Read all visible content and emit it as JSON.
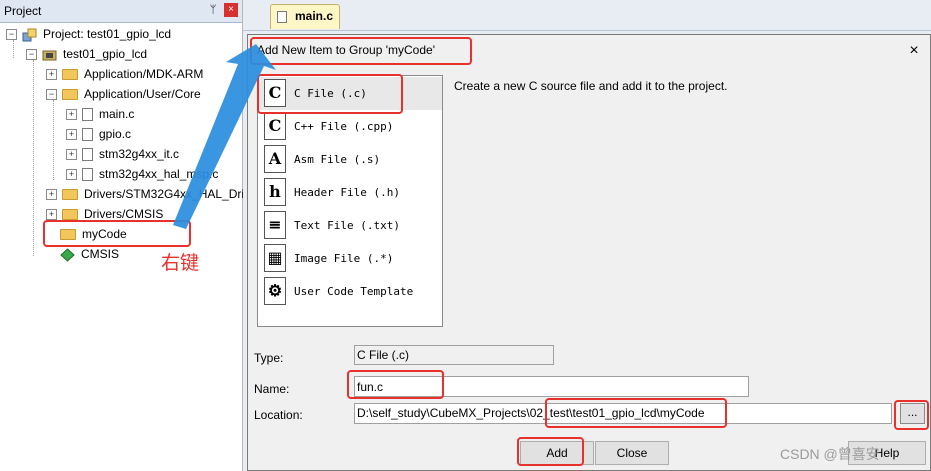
{
  "project_panel": {
    "title": "Project",
    "pin": "ᛘ",
    "close": "×",
    "tree": {
      "project": "Project: test01_gpio_lcd",
      "target": "test01_gpio_lcd",
      "groups": [
        "Application/MDK-ARM",
        "Application/User/Core",
        "Drivers/STM32G4xx_HAL_Dri",
        "Drivers/CMSIS",
        "myCode",
        "CMSIS"
      ],
      "files": [
        "main.c",
        "gpio.c",
        "stm32g4xx_it.c",
        "stm32g4xx_hal_msp.c"
      ]
    }
  },
  "editor": {
    "active_tab": "main.c"
  },
  "dialog": {
    "title": "Add New Item to Group 'myCode'",
    "close": "×",
    "description": "Create a new C source file and add it to the project.",
    "templates": [
      {
        "label": "C File (.c)",
        "glyph": "C",
        "icon": "c-file-icon"
      },
      {
        "label": "C++ File (.cpp)",
        "glyph": "C",
        "icon": "cpp-file-icon"
      },
      {
        "label": "Asm File (.s)",
        "glyph": "A",
        "icon": "asm-file-icon"
      },
      {
        "label": "Header File (.h)",
        "glyph": "h",
        "icon": "header-file-icon"
      },
      {
        "label": "Text File (.txt)",
        "glyph": "≡",
        "icon": "text-file-icon"
      },
      {
        "label": "Image File (.*)",
        "glyph": "▦",
        "icon": "image-file-icon"
      },
      {
        "label": "User Code Template",
        "glyph": "⚙",
        "icon": "gear-icon"
      }
    ],
    "type_label": "Type:",
    "type_value": "C File (.c)",
    "name_label": "Name:",
    "name_value": "fun.c",
    "location_label": "Location:",
    "location_value": "D:\\self_study\\CubeMX_Projects\\02_test\\test01_gpio_lcd\\myCode",
    "browse": "...",
    "add": "Add",
    "close_button": "Close",
    "help": "Help"
  },
  "annotation": {
    "text": "右键",
    "color": "#e8302c"
  },
  "watermark": "CSDN @曾喜安"
}
